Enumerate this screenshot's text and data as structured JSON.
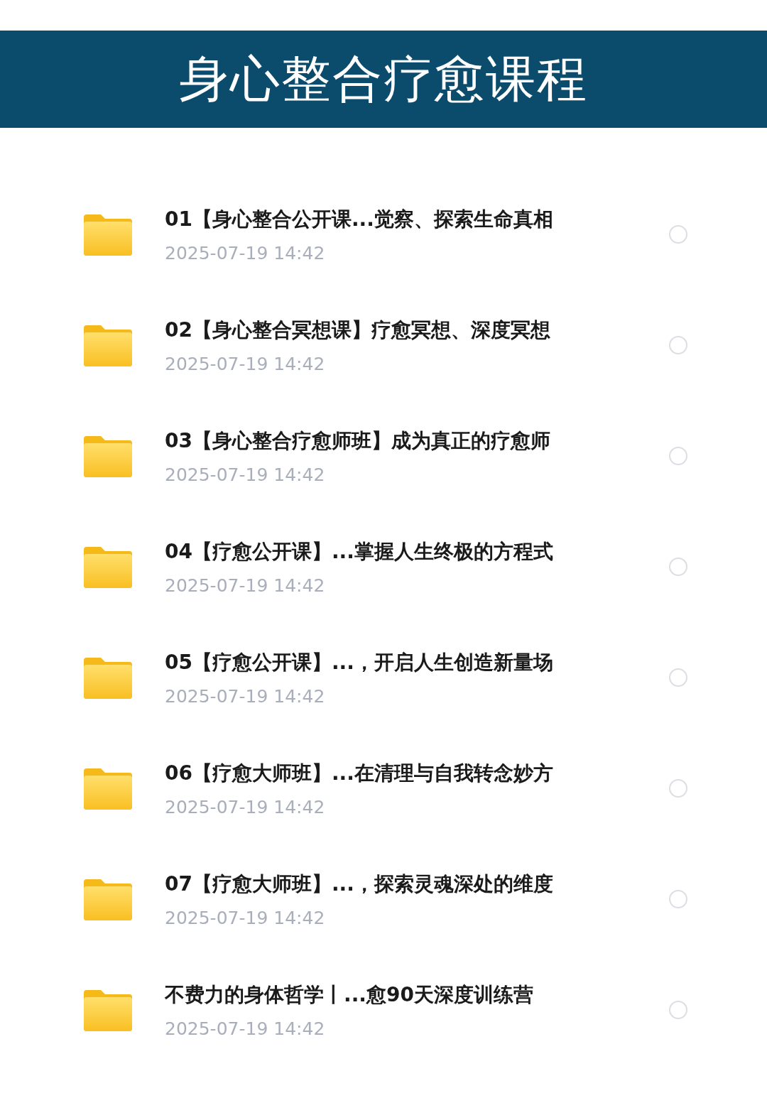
{
  "header": {
    "title": "身心整合疗愈课程"
  },
  "files": [
    {
      "name": "01【身心整合公开课...觉察、探索生命真相",
      "date": "2025-07-19 14:42",
      "selected": false
    },
    {
      "name": "02【身心整合冥想课】疗愈冥想、深度冥想",
      "date": "2025-07-19 14:42",
      "selected": false
    },
    {
      "name": "03【身心整合疗愈师班】成为真正的疗愈师",
      "date": "2025-07-19 14:42",
      "selected": false
    },
    {
      "name": "04【疗愈公开课】...掌握人生终极的方程式",
      "date": "2025-07-19 14:42",
      "selected": false
    },
    {
      "name": "05【疗愈公开课】...，开启人生创造新量场",
      "date": "2025-07-19 14:42",
      "selected": false
    },
    {
      "name": "06【疗愈大师班】...在清理与自我转念妙方",
      "date": "2025-07-19 14:42",
      "selected": false
    },
    {
      "name": "07【疗愈大师班】...，探索灵魂深处的维度",
      "date": "2025-07-19 14:42",
      "selected": false
    },
    {
      "name": "不费力的身体哲学丨...愈90天深度训练营",
      "date": "2025-07-19 14:42",
      "selected": false
    }
  ]
}
